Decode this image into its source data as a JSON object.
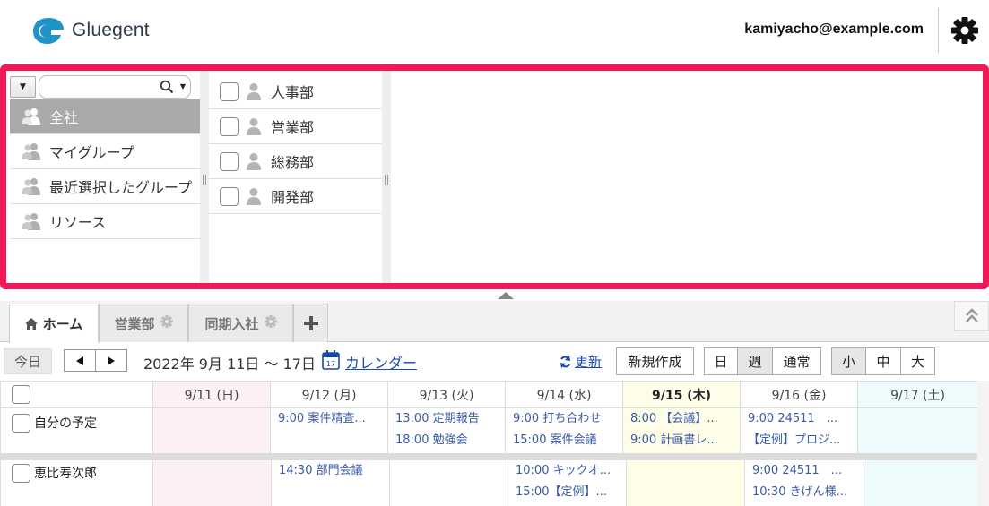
{
  "header": {
    "logo_text": "Gluegent",
    "user_email": "kamiyacho@example.com",
    "brand_color": "#1e94c9"
  },
  "picker": {
    "search": {
      "value": "",
      "placeholder": ""
    },
    "groups": [
      {
        "label": "全社",
        "selected": true
      },
      {
        "label": "マイグループ",
        "selected": false
      },
      {
        "label": "最近選択したグループ",
        "selected": false
      },
      {
        "label": "リソース",
        "selected": false
      }
    ],
    "departments": [
      {
        "label": "人事部",
        "checked": false
      },
      {
        "label": "営業部",
        "checked": false
      },
      {
        "label": "総務部",
        "checked": false
      },
      {
        "label": "開発部",
        "checked": false
      }
    ],
    "highlight_color": "#f0195a"
  },
  "tabs": [
    {
      "label": "ホーム",
      "active": true
    },
    {
      "label": "営業部",
      "active": false
    },
    {
      "label": "同期入社",
      "active": false
    }
  ],
  "toolbar": {
    "today": "今日",
    "date_range": "2022年 9月 11日 ～ 17日",
    "calendar_link": "カレンダー",
    "refresh": "更新",
    "new": "新規作成",
    "view_day": "日",
    "view_week": "週",
    "view_normal": "通常",
    "size_small": "小",
    "size_medium": "中",
    "size_large": "大"
  },
  "calendar": {
    "days": [
      "9/11 (日)",
      "9/12 (月)",
      "9/13 (火)",
      "9/14 (水)",
      "9/15 (木)",
      "9/16 (金)",
      "9/17 (土)"
    ],
    "rows": [
      {
        "name": "自分の予定",
        "events": [
          [],
          [
            "9:00 案件精査..."
          ],
          [
            "13:00 定期報告",
            "18:00 勉強会"
          ],
          [
            "9:00 打ち合わせ",
            "15:00 案件会議"
          ],
          [
            "8:00 【会議】...",
            "9:00 計画書レ..."
          ],
          [
            "9:00 24511　...",
            "【定例】プロジ..."
          ],
          []
        ]
      },
      {
        "name": "恵比寿次郎",
        "events": [
          [],
          [
            "14:30 部門会議"
          ],
          [],
          [
            "10:00 キックオ...",
            "15:00【定例】..."
          ],
          [],
          [
            "9:00 24511　...",
            "10:30 きげん様..."
          ],
          []
        ]
      }
    ]
  }
}
